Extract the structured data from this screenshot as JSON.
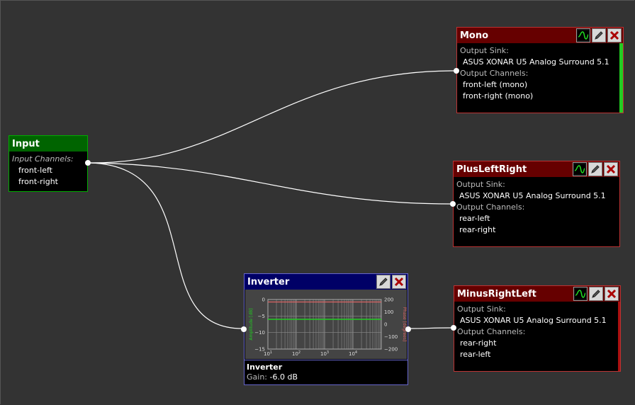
{
  "colors": {
    "canvas_bg": "#333333",
    "input_header": "#006400",
    "output_header": "#660000",
    "filter_header": "#000066",
    "wire": "#ffffff"
  },
  "input_node": {
    "title": "Input",
    "channels_label": "Input Channels:",
    "channels": [
      "front-left",
      "front-right"
    ]
  },
  "mono_node": {
    "title": "Mono",
    "sink_label": "Output Sink:",
    "sink": "ASUS XONAR U5 Analog Surround 5.1",
    "channels_label": "Output Channels:",
    "channels": [
      "front-left (mono)",
      "front-right (mono)"
    ]
  },
  "plus_node": {
    "title": "PlusLeftRight",
    "sink_label": "Output Sink:",
    "sink": "ASUS XONAR U5 Analog Surround 5.1",
    "channels_label": "Output Channels:",
    "channels": [
      "rear-left",
      "rear-right"
    ]
  },
  "minus_node": {
    "title": "MinusRightLeft",
    "sink_label": "Output Sink:",
    "sink": "ASUS XONAR U5 Analog Surround 5.1",
    "channels_label": "Output Channels:",
    "channels": [
      "rear-right",
      "rear-left"
    ]
  },
  "inverter_node": {
    "title": "Inverter",
    "filter_name": "Inverter",
    "gain_label": "Gain:",
    "gain_value": "-6.0 dB",
    "plot": {
      "left_axis_label": "Amplitude [dB]",
      "right_axis_label": "Phase [degrees]",
      "left_ticks": [
        "0",
        "−5",
        "−10",
        "−15"
      ],
      "right_ticks": [
        "200",
        "100",
        "0",
        "−100",
        "−200"
      ],
      "x_ticks": [
        "10",
        "10",
        "10",
        "10"
      ],
      "x_tick_exps": [
        "1",
        "2",
        "3",
        "4"
      ],
      "amplitude_db": -6.0,
      "phase_deg": 180
    }
  },
  "icons": {
    "plot": "waveform-icon",
    "edit": "pencil-icon",
    "remove": "close-icon"
  }
}
